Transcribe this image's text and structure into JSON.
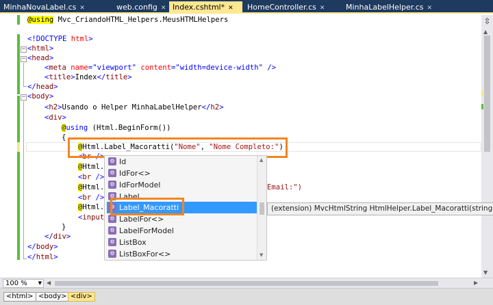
{
  "tabs": [
    {
      "label": "MinhaNovaLabel.cs",
      "active": false
    },
    {
      "label": "web.config",
      "active": false
    },
    {
      "label": "Index.cshtml*",
      "active": true
    },
    {
      "label": "HomeController.cs",
      "active": false
    },
    {
      "label": "MinhaLabelHelper.cs",
      "active": false
    }
  ],
  "code": {
    "l1_razor": "@using",
    "l1_ns": " Mvc_CriandoHTML_Helpers.MeusHTMLHelpers",
    "l3_doctype": "<!DOCTYPE",
    "l3_html": " html",
    "l3_close": ">",
    "l4_open": "<",
    "l4_tag": "html",
    "l4_close": ">",
    "l5_open": "<",
    "l5_tag": "head",
    "l5_close": ">",
    "l6_open": "<",
    "l6_tag": "meta",
    "l6_attr1": " name",
    "l6_eq1": "=",
    "l6_val1": "\"viewport\"",
    "l6_attr2": " content",
    "l6_eq2": "=",
    "l6_val2": "\"width=device-width\"",
    "l6_end": " />",
    "l7_open": "<",
    "l7_tag": "title",
    "l7_mid": ">",
    "l7_text": "Index",
    "l7_close": "</",
    "l7_tag2": "title",
    "l7_end": ">",
    "l8_open": "</",
    "l8_tag": "head",
    "l8_close": ">",
    "l9_open": "<",
    "l9_tag": "body",
    "l9_close": ">",
    "l10_open": "<",
    "l10_tag": "h2",
    "l10_mid": ">",
    "l10_text": "Usando o Helper MinhaLabelHelper",
    "l10_close": "</",
    "l10_tag2": "h2",
    "l10_end": ">",
    "l11_open": "<",
    "l11_tag": "div",
    "l11_close": ">",
    "l12_razor": "@",
    "l12_kw": "using",
    "l12_text": " (Html.BeginForm())",
    "l13_text": "{",
    "l14_razor": "@",
    "l14_text": "Html.Label_Macoratti(",
    "l14_s1": "\"Nome\"",
    "l14_comma": ", ",
    "l14_s2": "\"Nome Completo:\"",
    "l14_end": ")",
    "l15_open": "<",
    "l15_tag": "br",
    "l15_end": " />",
    "l16_razor": "@",
    "l16_text": "Html.",
    "l17_open": "<",
    "l17_tag": "br",
    "l17_end": " />",
    "l18_razor": "@",
    "l18_text": "Html.",
    "l18_tail": "Email:\")",
    "l19_open": "<",
    "l19_tag": "br",
    "l19_end": " />",
    "l20_razor": "@",
    "l20_text": "Html.",
    "l21_open": "<",
    "l21_tag": "input",
    "l22_text": "}",
    "l23_open": "</",
    "l23_tag": "div",
    "l23_close": ">",
    "l24_open": "</",
    "l24_tag": "body",
    "l24_close": ">",
    "l25_open": "</",
    "l25_tag": "html",
    "l25_close": ">"
  },
  "intellisense": {
    "items": [
      {
        "label": "Id",
        "selected": false
      },
      {
        "label": "IdFor<>",
        "selected": false
      },
      {
        "label": "IdForModel",
        "selected": false
      },
      {
        "label": "Label",
        "selected": false
      },
      {
        "label": "Label_Macoratti",
        "selected": true
      },
      {
        "label": "LabelFor<>",
        "selected": false
      },
      {
        "label": "LabelForModel",
        "selected": false
      },
      {
        "label": "ListBox",
        "selected": false
      },
      {
        "label": "ListBoxFor<>",
        "selected": false
      }
    ],
    "tooltip": "(extension) MvcHtmlString HtmlHelper.Label_Macoratti(string destino, string texto)"
  },
  "zoom": "100 %",
  "breadcrumbs": [
    "<html>",
    "<body>",
    "<div>"
  ],
  "colors": {
    "highlight": "#f28521",
    "selection": "#3399ff",
    "active_tab": "#ffe690",
    "tab_strip": "#1e3a5f"
  }
}
